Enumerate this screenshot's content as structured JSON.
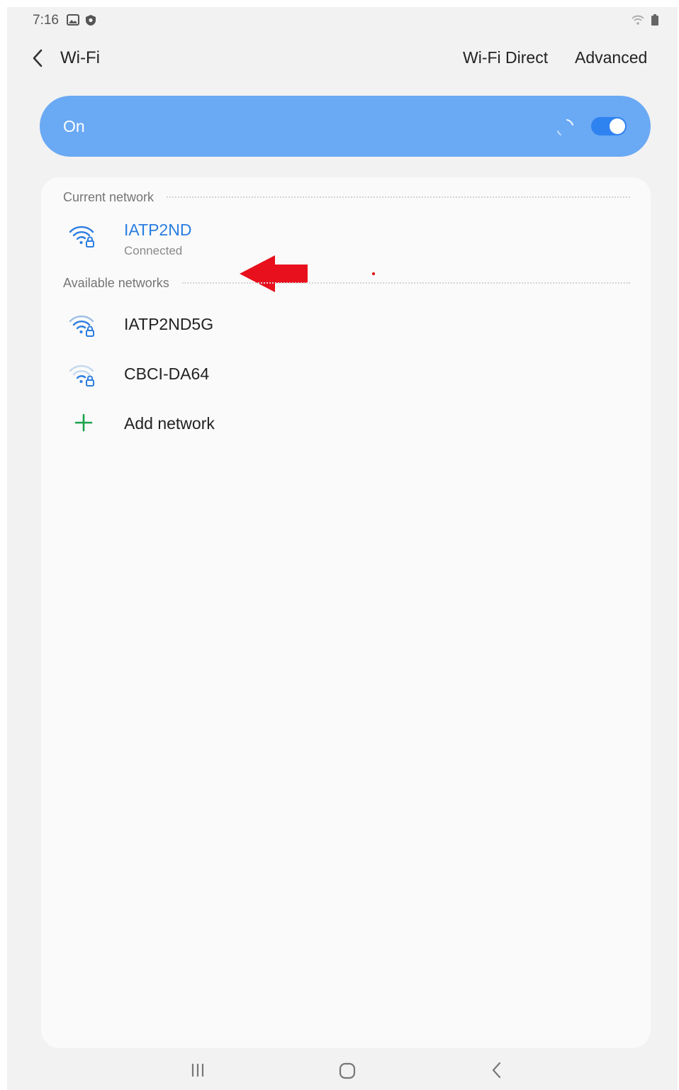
{
  "status_bar": {
    "time": "7:16",
    "left_icons": [
      "gallery-icon",
      "shield-icon"
    ],
    "right_icons": [
      "wifi-status-icon",
      "battery-icon"
    ]
  },
  "app_bar": {
    "title": "Wi-Fi",
    "wifi_direct_label": "Wi-Fi Direct",
    "advanced_label": "Advanced"
  },
  "master_toggle": {
    "label": "On",
    "enabled": true,
    "accent": "#6aa9f4"
  },
  "current_network": {
    "header": "Current network",
    "name": "IATP2ND",
    "status": "Connected",
    "color": "#2a7de1"
  },
  "available_networks": {
    "header": "Available networks",
    "items": [
      {
        "name": "IATP2ND5G",
        "icon": "wifi-lock-icon"
      },
      {
        "name": "CBCI-DA64",
        "icon": "wifi-lock-icon"
      }
    ]
  },
  "add_network": {
    "label": "Add network",
    "icon": "plus-icon",
    "color": "#1aa34a"
  },
  "annotation": {
    "arrow_color": "#e8101c"
  },
  "nav_bar": {
    "buttons": [
      "recent-apps-icon",
      "home-icon",
      "back-icon"
    ]
  }
}
